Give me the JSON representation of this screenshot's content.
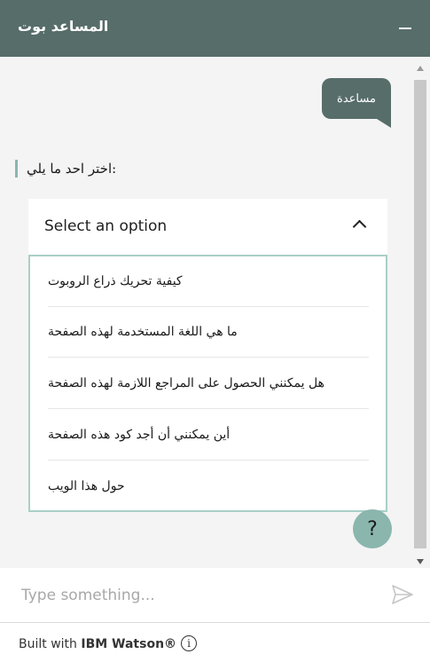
{
  "header": {
    "title": "المساعد بوت"
  },
  "chat": {
    "user_message": "مساعدة",
    "bot_prompt": "اختر احد ما يلي:",
    "dropdown": {
      "selected": "Select an option",
      "options": [
        "كيفية تحريك ذراع الروبوت",
        "ما هي اللغة المستخدمة لهذه الصفحة",
        "هل يمكنني الحصول على المراجع اللازمة لهذه الصفحة",
        "أين يمكنني أن أجد كود هذه الصفحة",
        "حول هذا الويب"
      ]
    },
    "help_label": "?"
  },
  "input": {
    "placeholder": "Type something..."
  },
  "footer": {
    "built_with": "Built with",
    "brand": "IBM Watson®",
    "info_glyph": "i"
  },
  "colors": {
    "header": "#576d6a",
    "accent": "#8ab6ad",
    "chat_bg": "#f4f4f4"
  },
  "icons": {
    "minimize": "minimize-icon",
    "send": "send-icon",
    "chevron": "chevron-up-icon",
    "info": "info-icon"
  }
}
